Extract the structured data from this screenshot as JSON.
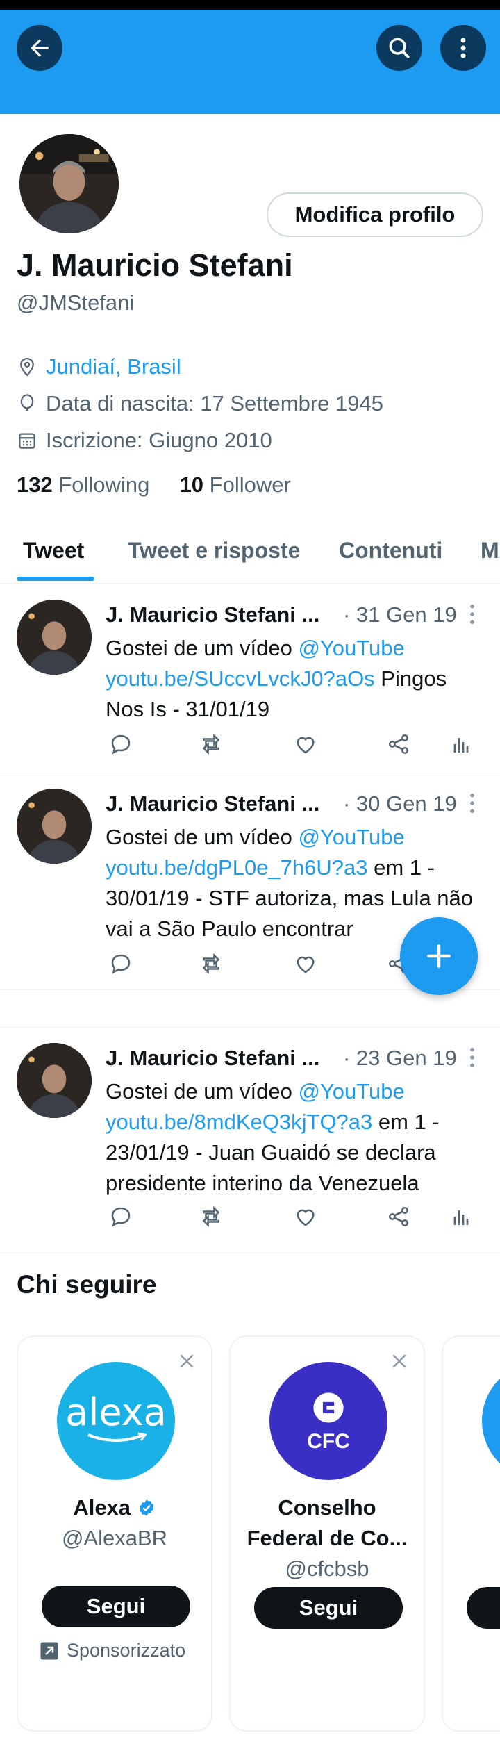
{
  "header": {
    "back_icon": "arrow-left-icon",
    "search_icon": "search-icon",
    "more_icon": "more-vertical-icon",
    "banner_color": "#1d9bf0"
  },
  "profile": {
    "edit_button": "Modifica profilo",
    "name": "J. Mauricio Stefani",
    "handle": "@JMStefani",
    "location": "Jundiaí, Brasil",
    "birth": "Data di nascita: 17 Settembre 1945",
    "joined": "Iscrizione: Giugno 2010",
    "following_count": "132",
    "following_label": "Following",
    "followers_count": "10",
    "followers_label": "Follower"
  },
  "tabs": [
    "Tweet",
    "Tweet e risposte",
    "Contenuti",
    "M"
  ],
  "tweets": [
    {
      "author": "J. Mauricio Stefani ...",
      "date": "· 31 Gen 19",
      "text_before": "Gostei de um vídeo ",
      "mention": "@YouTube",
      "link": "youtu.be/SUccvLvckJ0?aOs",
      "text_after": " Pingos Nos Is - 31/01/19"
    },
    {
      "author": "J. Mauricio Stefani ...",
      "date": "· 30 Gen 19",
      "text_before": "Gostei de um vídeo ",
      "mention": "@YouTube",
      "link": "youtu.be/dgPL0e_7h6U?a3",
      "text_after": " em 1 - 30/01/19 - STF autoriza, mas Lula não vai a São Paulo encontrar"
    },
    {
      "author": "J. Mauricio Stefani ...",
      "date": "· 23 Gen 19",
      "text_before": "Gostei de um vídeo ",
      "mention": "@YouTube",
      "link": "youtu.be/8mdKeQ3kjTQ?a3",
      "text_after": " em 1 - 23/01/19 - Juan Guaidó se declara presidente interino da Venezuela"
    }
  ],
  "who_to_follow": {
    "title": "Chi seguire",
    "cards": [
      {
        "name": "Alexa",
        "handle": "@AlexaBR",
        "button": "Segui",
        "sponsored": "Sponsorizzato",
        "logo_text": "alexa",
        "logo_color": "#1ab1e6"
      },
      {
        "name": "Conselho Federal de Co...",
        "handle": "@cfcbsb",
        "button": "Segui",
        "logo_text": "CFC",
        "logo_color": "#3a2fc4"
      },
      {
        "name": "",
        "handle": "",
        "button": "",
        "logo_color": "#1d9bf0"
      }
    ]
  },
  "colors": {
    "accent": "#1d9bf0",
    "text": "#0f1419",
    "muted": "#536471",
    "verified": "#1d9bf0"
  }
}
